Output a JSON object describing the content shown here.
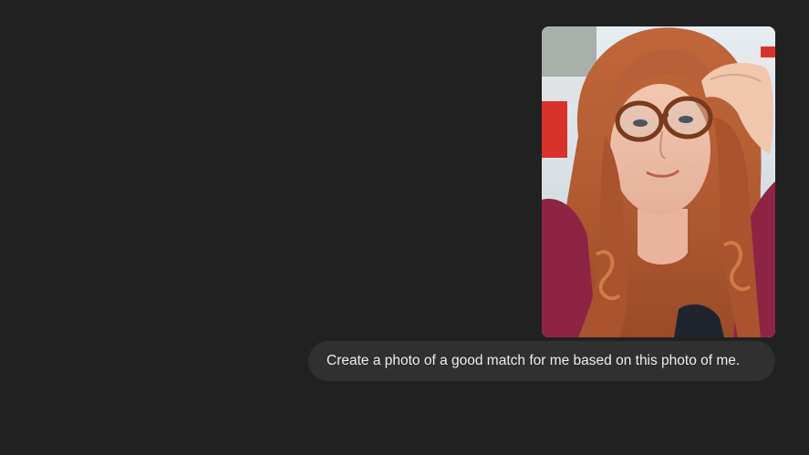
{
  "conversation": {
    "user_message": {
      "text": "Create a photo of a good match for me based on this photo of me.",
      "attachment": {
        "type": "image",
        "alt": "Selfie of a woman with long wavy red hair and tortoiseshell glasses"
      }
    }
  },
  "colors": {
    "background": "#212121",
    "bubble": "#303030",
    "text": "#ececec"
  }
}
